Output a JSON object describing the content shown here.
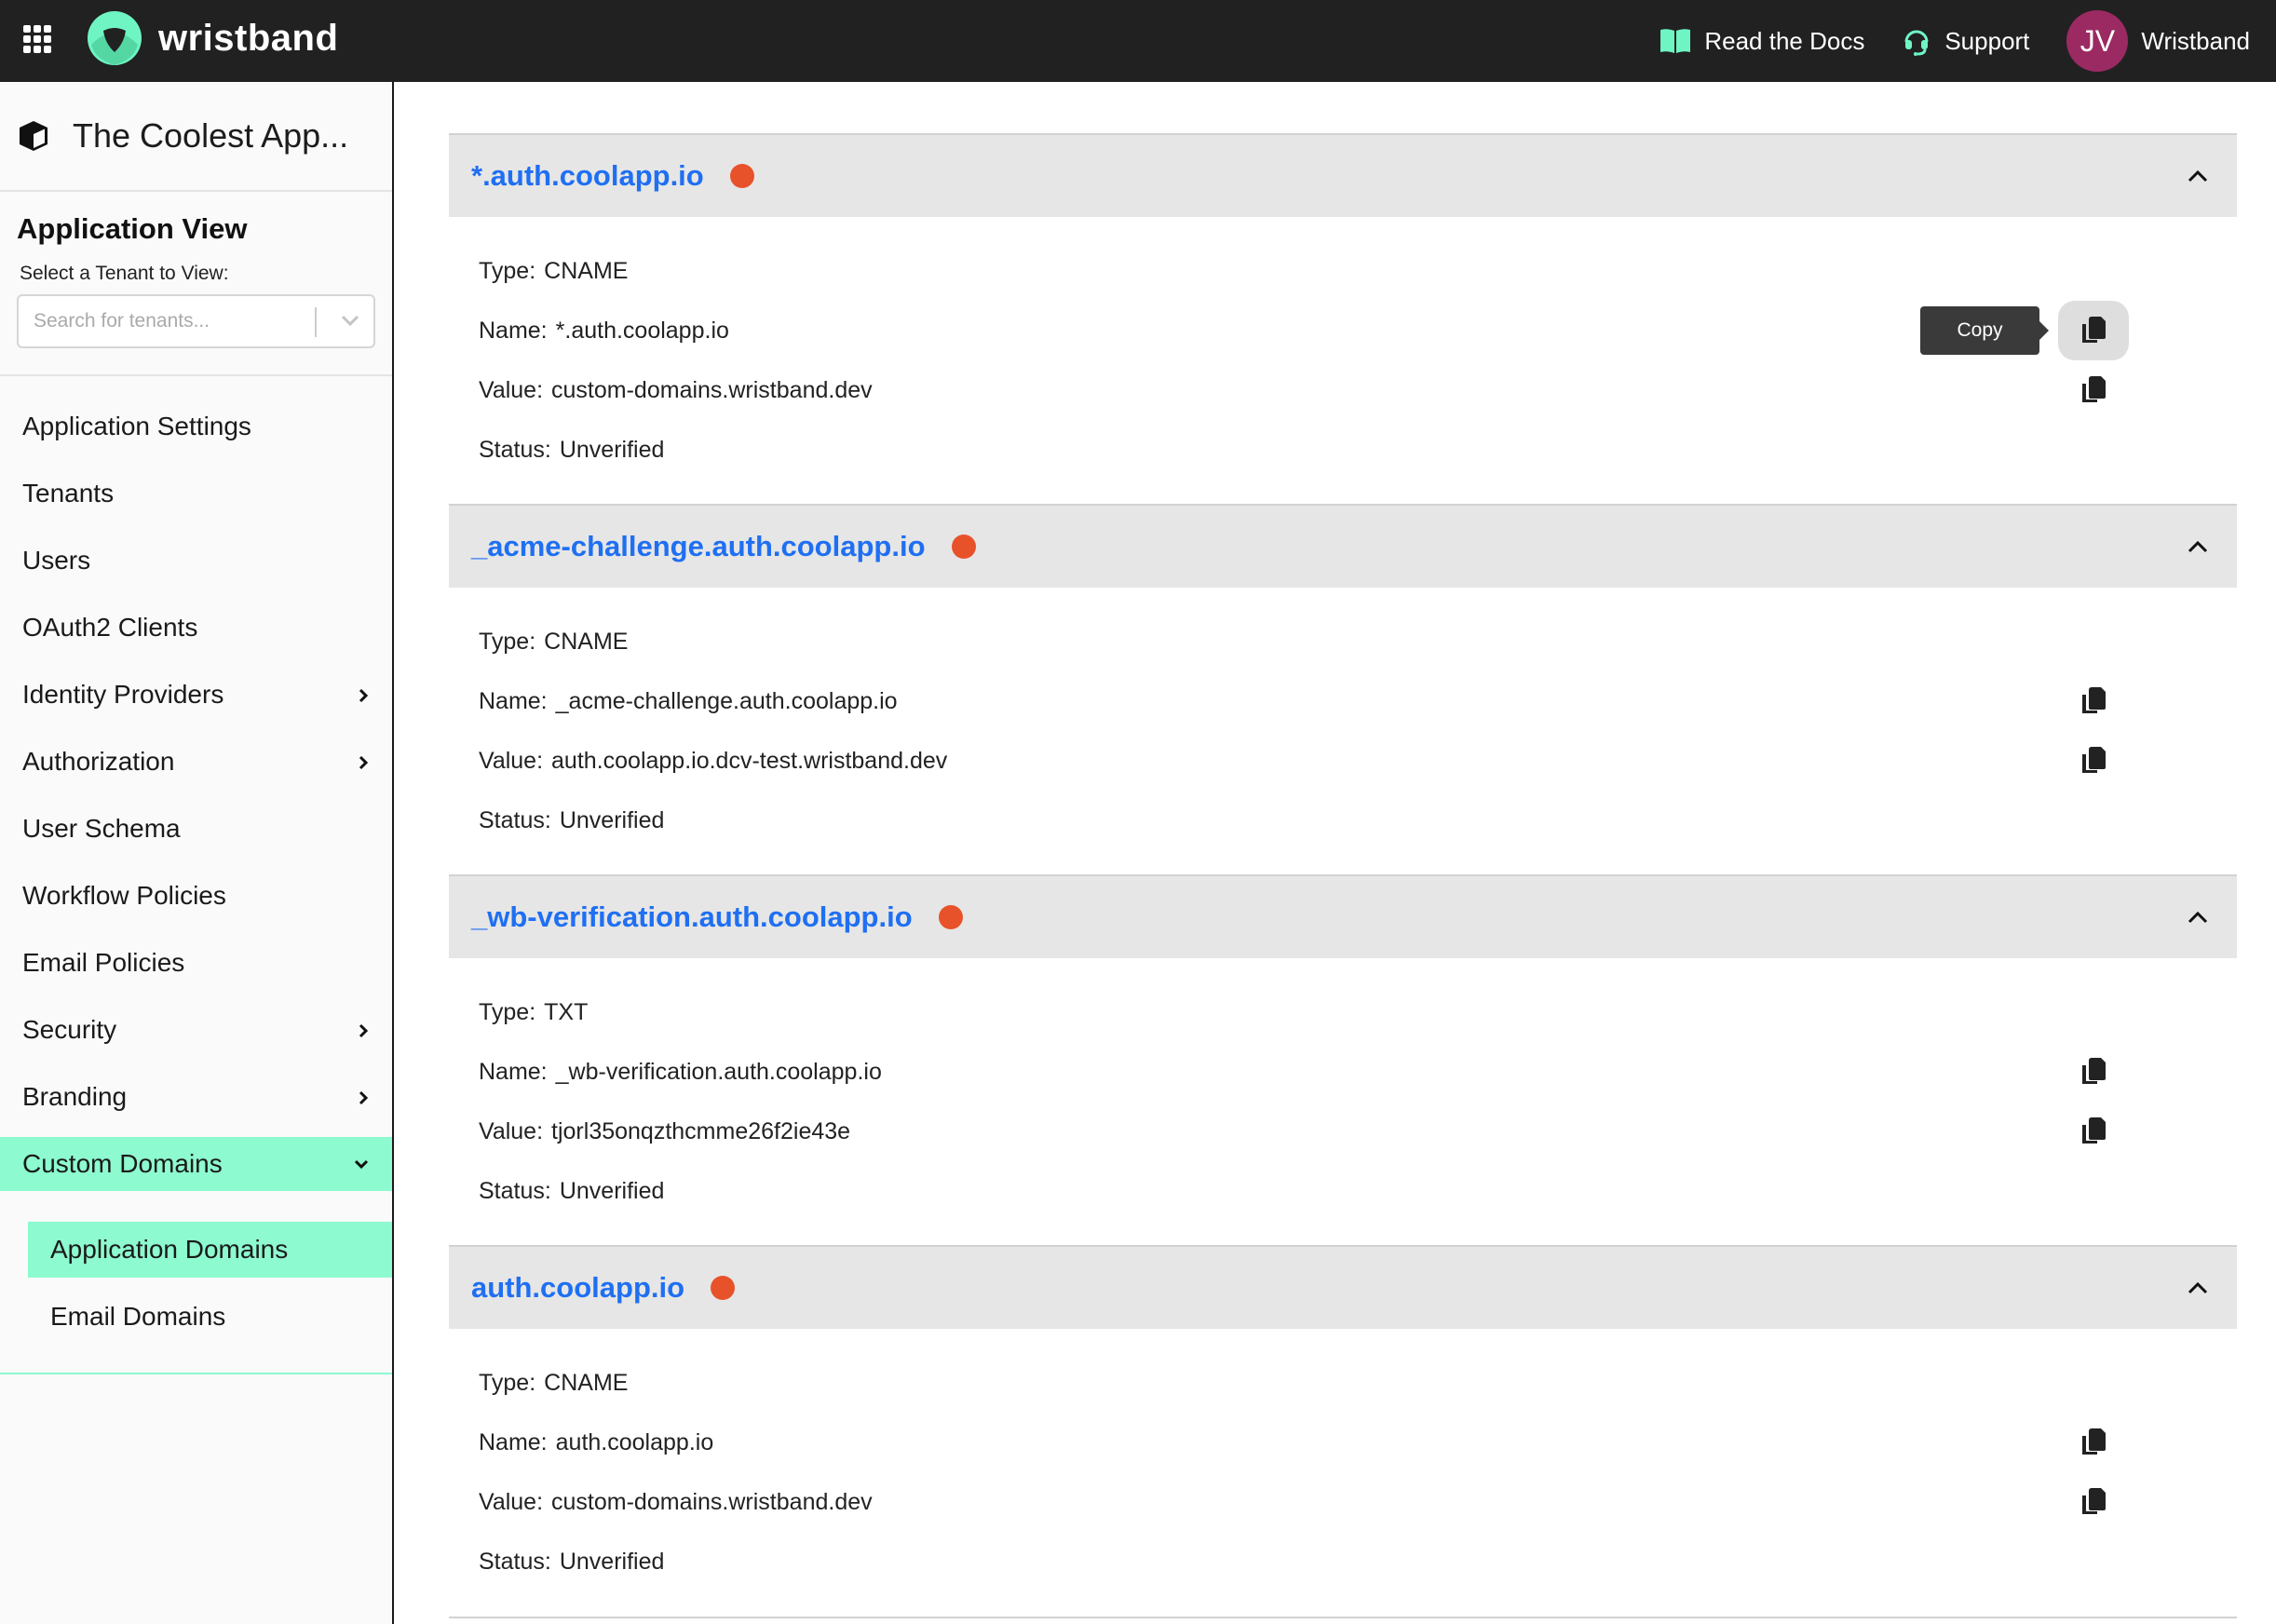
{
  "header": {
    "brand": "wristband",
    "links": [
      {
        "label": "Read the Docs",
        "icon": "book-icon"
      },
      {
        "label": "Support",
        "icon": "headset-icon"
      }
    ],
    "avatar_initials": "JV",
    "account_name": "Wristband",
    "colors": {
      "bar": "#212121",
      "accent": "#6ff5c4",
      "avatar": "#9b2a63"
    }
  },
  "sidebar": {
    "app_title": "The Coolest App...",
    "view_title": "Application View",
    "tenant_label": "Select a Tenant to View:",
    "tenant_placeholder": "Search for tenants...",
    "items": [
      {
        "label": "Application Settings",
        "chevron": false
      },
      {
        "label": "Tenants",
        "chevron": false
      },
      {
        "label": "Users",
        "chevron": false
      },
      {
        "label": "OAuth2 Clients",
        "chevron": false
      },
      {
        "label": "Identity Providers",
        "chevron": true
      },
      {
        "label": "Authorization",
        "chevron": true
      },
      {
        "label": "User Schema",
        "chevron": false
      },
      {
        "label": "Workflow Policies",
        "chevron": false
      },
      {
        "label": "Email Policies",
        "chevron": false
      },
      {
        "label": "Security",
        "chevron": true
      },
      {
        "label": "Branding",
        "chevron": true
      },
      {
        "label": "Custom Domains",
        "chevron": "down",
        "active": true
      }
    ],
    "subitems": [
      {
        "label": "Application Domains",
        "active": true
      },
      {
        "label": "Email Domains",
        "active": false
      }
    ],
    "active_color": "#8dfad0"
  },
  "main": {
    "labels": {
      "type": "Type:",
      "name": "Name:",
      "value": "Value:",
      "status": "Status:"
    },
    "tooltip": "Copy",
    "status_dot_color": "#e8522a",
    "link_color": "#1f6ff2",
    "domains": [
      {
        "title": "*.auth.coolapp.io",
        "type": "CNAME",
        "name": "*.auth.coolapp.io",
        "value": "custom-domains.wristband.dev",
        "status": "Unverified"
      },
      {
        "title": "_acme-challenge.auth.coolapp.io",
        "type": "CNAME",
        "name": "_acme-challenge.auth.coolapp.io",
        "value": "auth.coolapp.io.dcv-test.wristband.dev",
        "status": "Unverified"
      },
      {
        "title": "_wb-verification.auth.coolapp.io",
        "type": "TXT",
        "name": "_wb-verification.auth.coolapp.io",
        "value": "tjorl35onqzthcmme26f2ie43e",
        "status": "Unverified"
      },
      {
        "title": "auth.coolapp.io",
        "type": "CNAME",
        "name": "auth.coolapp.io",
        "value": "custom-domains.wristband.dev",
        "status": "Unverified"
      }
    ]
  }
}
